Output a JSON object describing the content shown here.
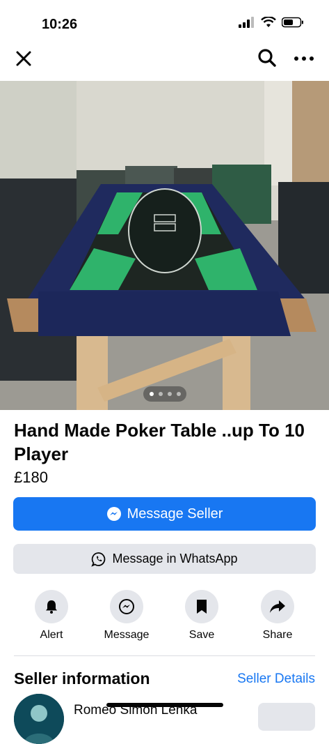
{
  "status_bar": {
    "time": "10:26"
  },
  "nav": {
    "close_icon": "close-icon",
    "search_icon": "search-icon",
    "more_icon": "more-horizontal-icon"
  },
  "carousel": {
    "total_images": 4,
    "current_image": 1
  },
  "listing": {
    "title": "Hand Made Poker Table ..up To 10 Player",
    "price": "£180"
  },
  "buttons": {
    "message_seller": "Message Seller",
    "whatsapp": "Message in WhatsApp"
  },
  "actions": [
    {
      "label": "Alert",
      "icon": "bell-icon"
    },
    {
      "label": "Message",
      "icon": "messenger-icon"
    },
    {
      "label": "Save",
      "icon": "bookmark-icon"
    },
    {
      "label": "Share",
      "icon": "share-arrow-icon"
    }
  ],
  "seller": {
    "heading": "Seller information",
    "details_link": "Seller Details",
    "name": "Romeo Simon Lenka"
  },
  "colors": {
    "accent": "#1877f2",
    "secondary_bg": "#e4e6eb",
    "felt_green": "#2fb36b"
  }
}
